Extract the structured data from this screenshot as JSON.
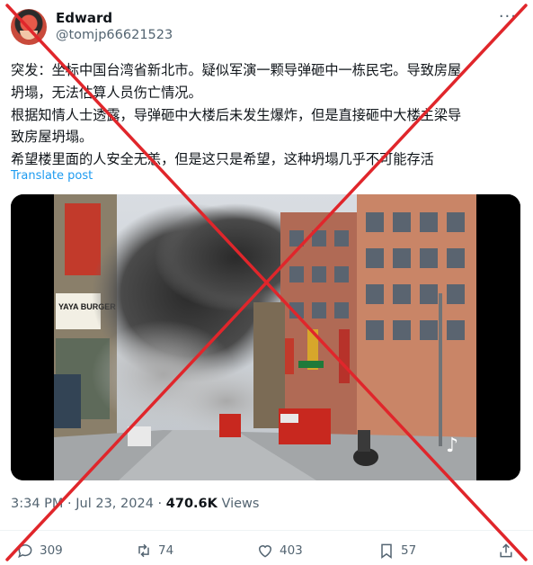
{
  "author": {
    "name": "Edward",
    "handle": "@tomjp66621523"
  },
  "post": {
    "lines": [
      "突发：坐标中国台湾省新北市。疑似军演一颗导弹砸中一栋民宅。导致房屋",
      "坍塌，无法估算人员伤亡情况。",
      "根据知情人士透露，导弹砸中大楼后未发生爆炸，但是直接砸中大楼主梁导",
      "致房屋坍塌。",
      "希望楼里面的人安全无恙，但是这只是希望，这种坍塌几乎不可能存活"
    ],
    "translate_label": "Translate post"
  },
  "media": {
    "sign_text": "YAYA BURGER"
  },
  "meta": {
    "time_date": "3:34 PM · Jul 23, 2024 · ",
    "views_count": "470.6K",
    "views_label": " Views"
  },
  "actions": {
    "replies": "309",
    "reposts": "74",
    "likes": "403",
    "bookmarks": "57"
  },
  "colors": {
    "accent": "#1d9bf0",
    "muted": "#536471",
    "overlay_x": "#e0262b"
  }
}
